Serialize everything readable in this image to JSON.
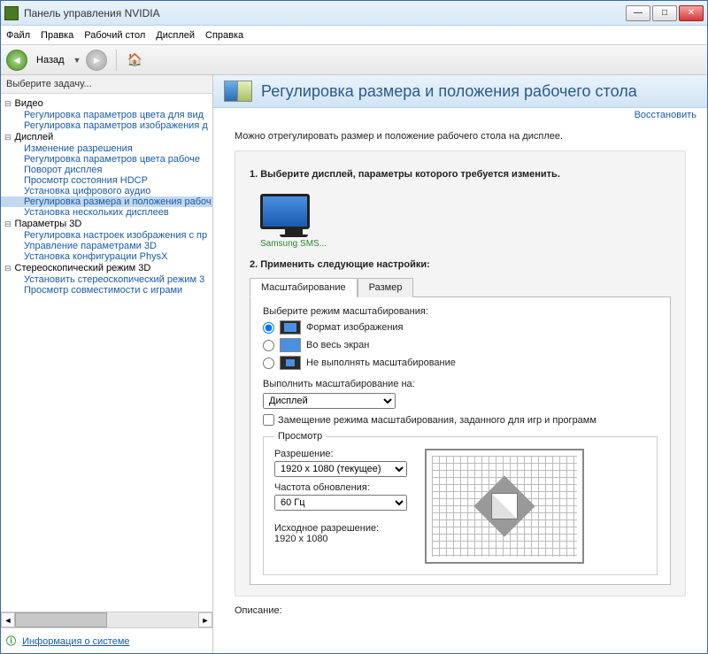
{
  "window": {
    "title": "Панель управления NVIDIA"
  },
  "menu": {
    "file": "Файл",
    "edit": "Правка",
    "desktop": "Рабочий стол",
    "display": "Дисплей",
    "help": "Справка"
  },
  "toolbar": {
    "back": "Назад"
  },
  "sidebar": {
    "task_label": "Выберите задачу...",
    "categories": {
      "video": "Видео",
      "display": "Дисплей",
      "params3d": "Параметры 3D",
      "stereo": "Стереоскопический режим 3D"
    },
    "items": {
      "video_color": "Регулировка параметров цвета для вид",
      "video_image": "Регулировка параметров изображения д",
      "disp_res": "Изменение разрешения",
      "disp_color": "Регулировка параметров цвета рабоче",
      "disp_rotate": "Поворот дисплея",
      "disp_hdcp": "Просмотр состояния HDCP",
      "disp_audio": "Установка цифрового аудио",
      "disp_resize": "Регулировка размера и положения рабоч",
      "disp_multi": "Установка нескольких дисплеев",
      "p3d_image": "Регулировка настроек изображения с пр",
      "p3d_manage": "Управление параметрами 3D",
      "p3d_physx": "Установка конфигурации PhysX",
      "st_set": "Установить стереоскопический режим 3",
      "st_compat": "Просмотр совместимости с играми"
    },
    "sysinfo": "Информация о системе"
  },
  "content": {
    "title": "Регулировка размера и положения рабочего стола",
    "restore": "Восстановить",
    "intro": "Можно отрегулировать размер и положение рабочего стола на дисплее.",
    "step1": "1. Выберите дисплей, параметры которого требуется изменить.",
    "monitor_label": "Samsung SMS...",
    "step2": "2. Применить следующие настройки:",
    "tabs": {
      "scaling": "Масштабирование",
      "size": "Размер"
    },
    "scaling": {
      "mode_label": "Выберите режим масштабирования:",
      "opt_aspect": "Формат изображения",
      "opt_full": "Во весь экран",
      "opt_none": "Не выполнять масштабирование",
      "perform_on": "Выполнить масштабирование на:",
      "perform_value": "Дисплей",
      "override": "Замещение режима масштабирования, заданного для игр и программ"
    },
    "preview": {
      "legend": "Просмотр",
      "res_label": "Разрешение:",
      "res_value": "1920 x 1080 (текущее)",
      "refresh_label": "Частота обновления:",
      "refresh_value": "60 Гц",
      "native_label": "Исходное разрешение:",
      "native_value": "1920 x 1080"
    },
    "desc": "Описание:"
  }
}
